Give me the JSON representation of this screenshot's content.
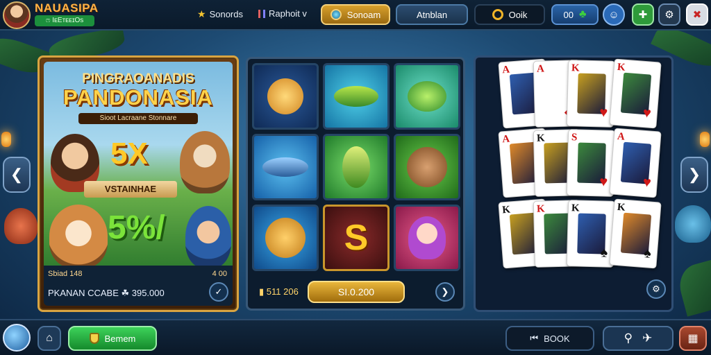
{
  "header": {
    "brand": "NAUASIPA",
    "brand_sub": "ෆ IᴇEᴛᴇᴇɪOs",
    "nav": [
      {
        "label": "Sonords",
        "icon": "star-icon"
      },
      {
        "label": "Raphoit v",
        "icon": "chart-icon"
      }
    ],
    "gold_button": "Sonoam",
    "blue_button": "Atnblan",
    "dark_button": "Ooik",
    "score": "00",
    "accent_gold": "#d7a02c",
    "accent_green": "#1c8f3c"
  },
  "promo": {
    "title_top": "PINGRAOANADIS",
    "title_main": "PANDONASIA",
    "subtitle": "Sioot Lacraane Stonnare",
    "multiplier": "5X",
    "ribbon": "VSTAINHAE",
    "percent": "5%/",
    "footer_small_left": "Sbiad 148",
    "footer_small_right": "4 00",
    "footer_main": "PKANAN CCABE ☘ 395.000"
  },
  "slots": {
    "balance": "511 206",
    "spin_label": "SI.0.200",
    "tiles": [
      "lion-icon",
      "fish-icon",
      "frog-fish-icon",
      "tuna-icon",
      "green-fish-icon",
      "bear-icon",
      "lion-icon",
      "s-symbol-icon",
      "girl-icon"
    ],
    "s_symbol": "S"
  },
  "cards": {
    "rows": [
      [
        {
          "rank": "A",
          "suit": "♥",
          "color": "red"
        },
        {
          "rank": "A",
          "suit": "◆",
          "color": "red"
        },
        {
          "rank": "K",
          "suit": "♥",
          "color": "red"
        },
        {
          "rank": "K",
          "suit": "♥",
          "color": "red"
        }
      ],
      [
        {
          "rank": "A",
          "suit": "♥",
          "color": "red"
        },
        {
          "rank": "K",
          "suit": "♠",
          "color": "black"
        },
        {
          "rank": "S",
          "suit": "♥",
          "color": "red"
        },
        {
          "rank": "A",
          "suit": "♥",
          "color": "red"
        }
      ],
      [
        {
          "rank": "K",
          "suit": "♠",
          "color": "black"
        },
        {
          "rank": "K",
          "suit": "♥",
          "color": "red"
        },
        {
          "rank": "K",
          "suit": "♠",
          "color": "black"
        },
        {
          "rank": "K",
          "suit": "♠",
          "color": "black"
        }
      ]
    ]
  },
  "bottom": {
    "green_button": "Bemem",
    "book_label": "BOOK",
    "book_icon": "skip-icon"
  }
}
